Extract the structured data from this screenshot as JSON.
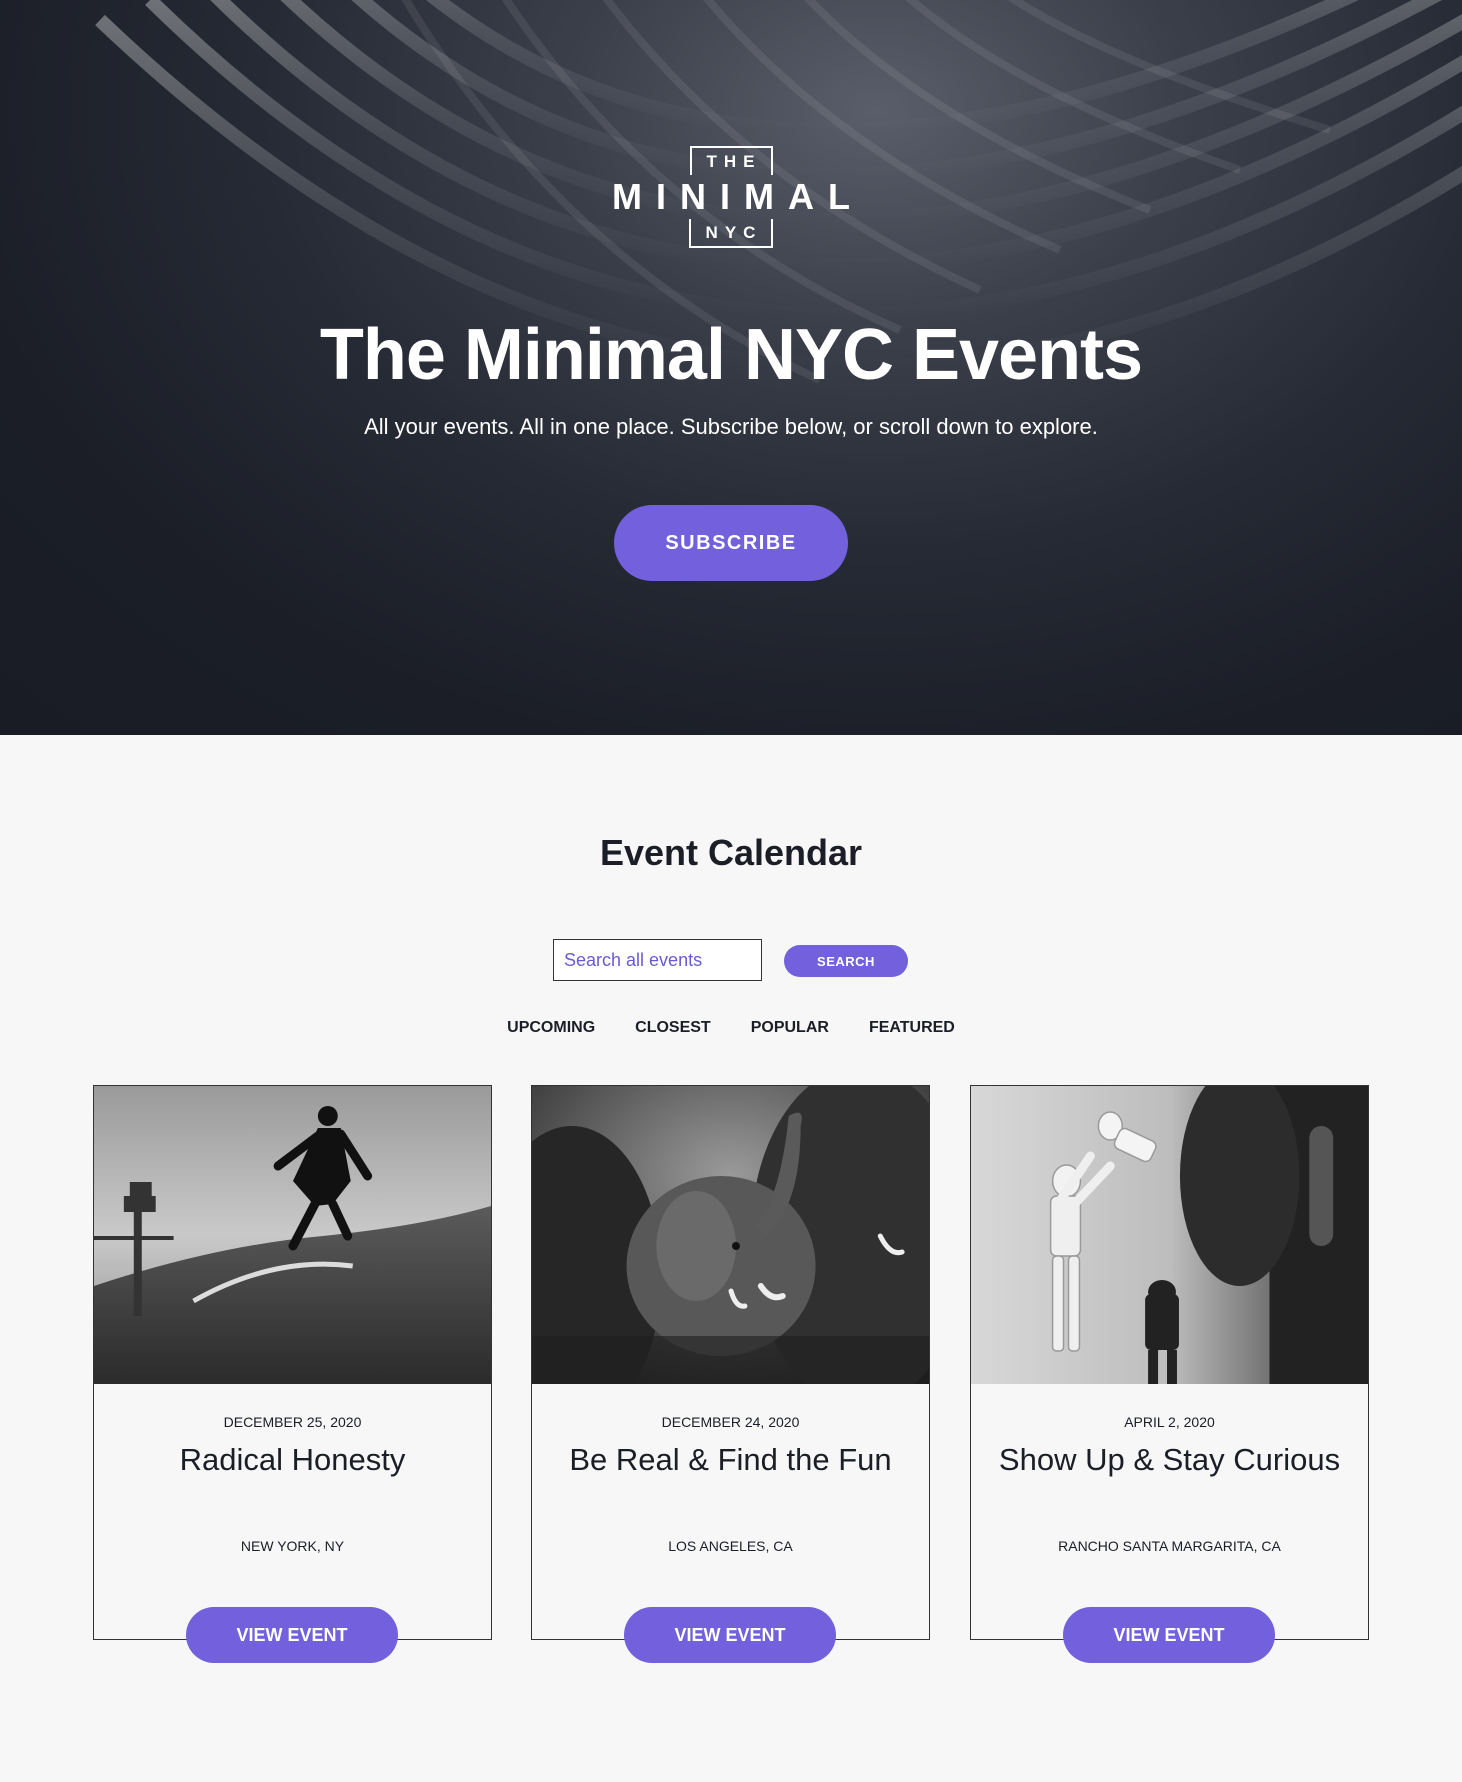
{
  "hero": {
    "logo": {
      "top": "THE",
      "main": "MINIMAL",
      "bottom": "NYC"
    },
    "title": "The Minimal NYC Events",
    "subtitle": "All your events. All in one place. Subscribe below, or scroll down to explore.",
    "subscribe_label": "SUBSCRIBE"
  },
  "calendar": {
    "title": "Event Calendar",
    "search": {
      "placeholder": "Search all events",
      "button_label": "SEARCH"
    },
    "filters": [
      "UPCOMING",
      "CLOSEST",
      "POPULAR",
      "FEATURED"
    ],
    "events": [
      {
        "date": "DECEMBER 25, 2020",
        "title": "Radical Honesty",
        "location": "NEW YORK, NY",
        "button_label": "VIEW EVENT",
        "image": "surfer-photo"
      },
      {
        "date": "DECEMBER 24, 2020",
        "title": "Be Real & Find the Fun",
        "location": "LOS ANGELES, CA",
        "button_label": "VIEW EVENT",
        "image": "elephants-photo"
      },
      {
        "date": "APRIL 2, 2020",
        "title": "Show Up & Stay Curious",
        "location": "RANCHO SANTA MARGARITA, CA",
        "button_label": "VIEW EVENT",
        "image": "stormtrooper-toys-photo"
      }
    ]
  },
  "colors": {
    "accent": "#7260dc",
    "hero_bg": "#1b1e27",
    "page_bg": "#f7f7f7"
  }
}
